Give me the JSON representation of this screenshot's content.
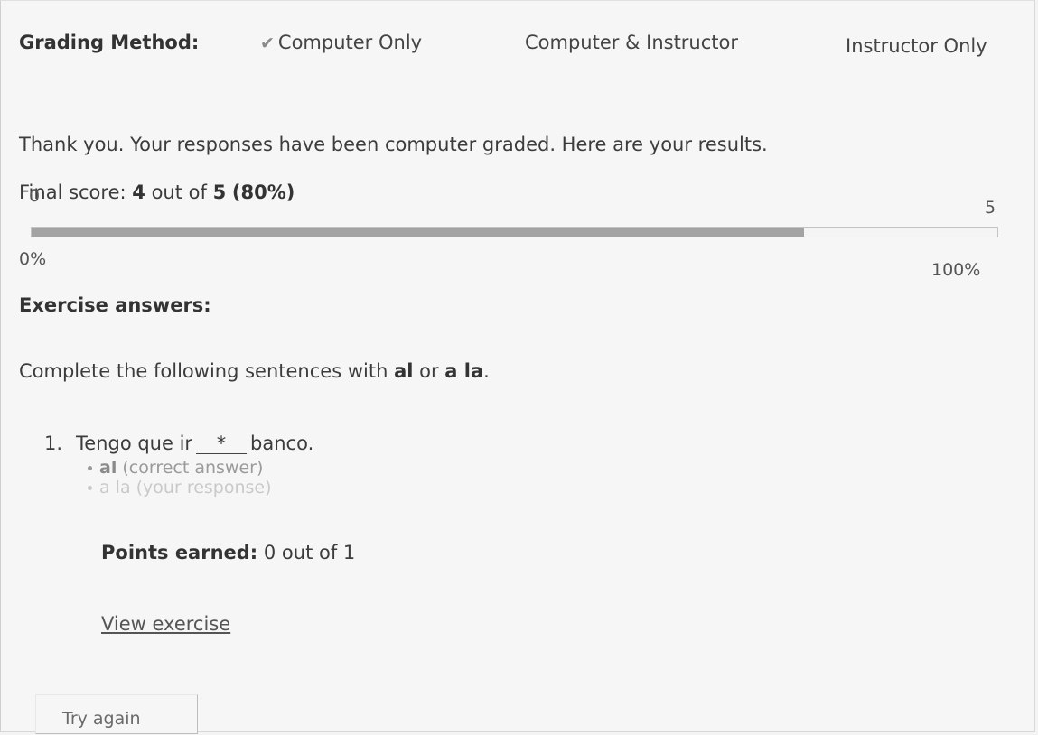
{
  "grading": {
    "label": "Grading Method:",
    "options": [
      "Computer Only",
      "Computer & Instructor",
      "Instructor Only"
    ],
    "selected_mark": "✔"
  },
  "message": "Thank you. Your responses have been computer graded. Here are your results.",
  "score": {
    "prefix": "Final score: ",
    "earned": "4",
    "middle": " out of ",
    "total": "5",
    "percent": "(80%)",
    "fraction": 0.8,
    "axis_min": "0",
    "axis_max": "5",
    "pct_min": "0%",
    "pct_max": "100%"
  },
  "exercise_header": "Exercise answers:",
  "instructions": {
    "prefix": "Complete the following sentences with ",
    "opt1": "al",
    "or": " or ",
    "opt2": "a la",
    "suffix": "."
  },
  "questions": [
    {
      "number": "1.",
      "before": "Tengo que ir",
      "blank": "*",
      "after": "banco.",
      "correct_word": "al",
      "correct_note": " (correct answer)",
      "response": "a la (your response)",
      "points_label": "Points earned:",
      "points_value": " 0 out of 1"
    }
  ],
  "view_link": "View exercise",
  "try_again": "Try again"
}
